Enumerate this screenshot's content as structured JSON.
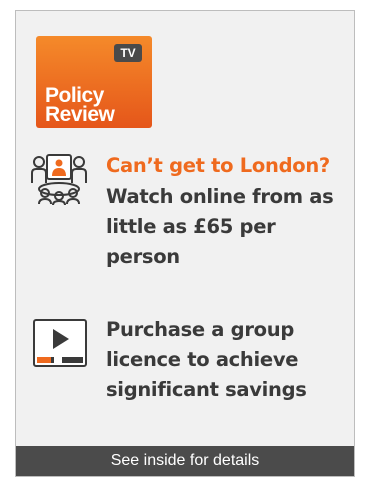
{
  "logo": {
    "badge": "TV",
    "line1": "Policy",
    "line2": "Review"
  },
  "feature_1": {
    "icon": "group-video-icon",
    "headline": "Can’t get to London?",
    "text": "Watch online from as little as £65 per person"
  },
  "feature_2": {
    "icon": "video-player-icon",
    "text": "Purchase a group licence to achieve significant savings"
  },
  "footer": {
    "text": "See inside for details"
  },
  "colors": {
    "accent_orange": "#ef6a1e",
    "dark_text": "#3a3a3a",
    "footer_bg": "#4b4b4b",
    "badge_bg": "#4a4a4a",
    "panel_bg": "#f1f1f1"
  }
}
